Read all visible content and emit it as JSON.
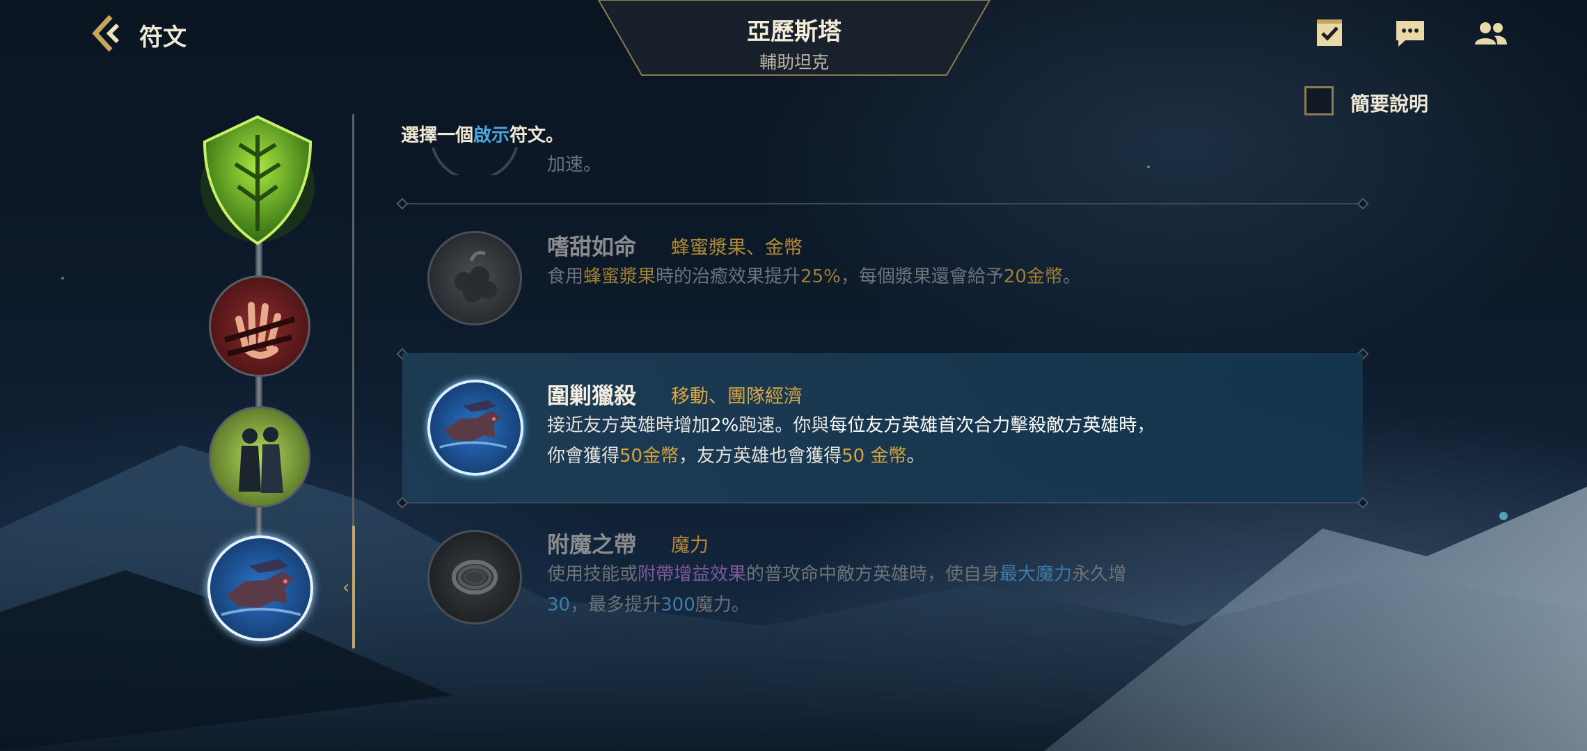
{
  "header": {
    "page_title": "符文",
    "champion_name": "亞歷斯塔",
    "champion_role": "輔助坦克"
  },
  "summary_toggle": {
    "label": "簡要說明",
    "checked": false
  },
  "prompt": {
    "before": "選擇一個",
    "highlight": "啟示",
    "after": "符文。"
  },
  "partial_row": {
    "desc_fragment": "加速。"
  },
  "runes": [
    {
      "name": "嗜甜如命",
      "tags": "蜂蜜漿果、金幣",
      "desc_line1_parts": [
        "食用",
        "蜂蜜漿果",
        "時的治癒效果提升",
        "25%",
        "，每個漿果還會給予",
        "20金幣",
        "。"
      ],
      "active": false
    },
    {
      "name": "圍剿獵殺",
      "tags": "移動、團隊經濟",
      "desc_line1_parts": [
        "接近友方英雄時增加",
        "2%",
        "跑速。你與",
        "每位友方英雄首次合力擊殺敵方英雄時",
        "，"
      ],
      "desc_line2_parts": [
        "你會獲得",
        "50金幣",
        "，友方英雄也會獲得",
        "50 金幣",
        "。"
      ],
      "active": true
    },
    {
      "name": "附魔之帶",
      "tags": "魔力",
      "desc_line1_parts": [
        "使用技能或",
        "附帶增益效果",
        "的普攻命中敵方英雄時，使自身",
        "最大魔力",
        "永久增"
      ],
      "desc_line2_parts": [
        "30",
        "，最多提升",
        "300",
        "魔力。"
      ],
      "active": false
    }
  ],
  "icons": {
    "back": "back-chevron-icon",
    "top_right": [
      "quest-checklist-icon",
      "chat-bubble-icon",
      "friends-icon"
    ],
    "rune_tree": [
      "resolve-shield-icon",
      "hand-grasp-icon",
      "allies-duo-icon",
      "wolf-pack-icon"
    ]
  },
  "colors": {
    "accent_gold": "#c8a55c",
    "highlight_blue": "#4aa7e0",
    "tag_gold": "#d8a943"
  }
}
